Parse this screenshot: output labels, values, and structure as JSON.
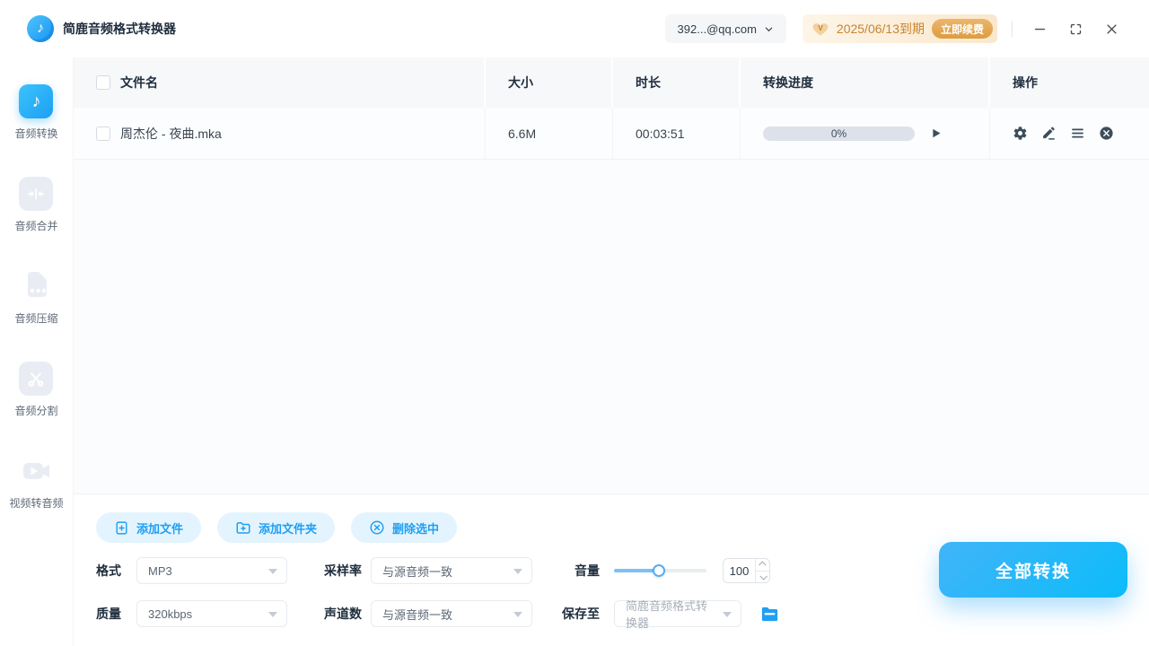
{
  "app": {
    "title": "简鹿音频格式转换器"
  },
  "header": {
    "account": "392...@qq.com",
    "vip": {
      "expiry": "2025/06/13到期",
      "renew": "立即续费"
    }
  },
  "sidebar": {
    "items": [
      {
        "label": "音频转换",
        "active": true
      },
      {
        "label": "音频合并",
        "active": false
      },
      {
        "label": "音频压缩",
        "active": false
      },
      {
        "label": "音频分割",
        "active": false
      },
      {
        "label": "视频转音频",
        "active": false
      }
    ]
  },
  "table": {
    "columns": [
      "文件名",
      "大小",
      "时长",
      "转换进度",
      "操作"
    ],
    "rows": [
      {
        "name": "周杰伦 - 夜曲.mka",
        "size": "6.6M",
        "duration": "00:03:51",
        "progress": "0%",
        "progress_value": 0
      }
    ]
  },
  "actions": {
    "add_file": "添加文件",
    "add_folder": "添加文件夹",
    "delete_selected": "删除选中"
  },
  "settings": {
    "format": {
      "label": "格式",
      "value": "MP3"
    },
    "sample_rate": {
      "label": "采样率",
      "value": "与源音频一致"
    },
    "volume": {
      "label": "音量",
      "value": "100",
      "percent": 49
    },
    "quality": {
      "label": "质量",
      "value": "320kbps"
    },
    "channels": {
      "label": "声道数",
      "value": "与源音频一致"
    },
    "save_to": {
      "label": "保存至",
      "value": "简鹿音频格式转换器"
    }
  },
  "convert_all_label": "全部转换",
  "colors": {
    "accent": "#1f9ff2",
    "accent_light_bg": "#e3f4fe",
    "vip_text": "#c9842e",
    "renew_gold": "#dd9c40",
    "progress_track": "#dde2ea"
  }
}
